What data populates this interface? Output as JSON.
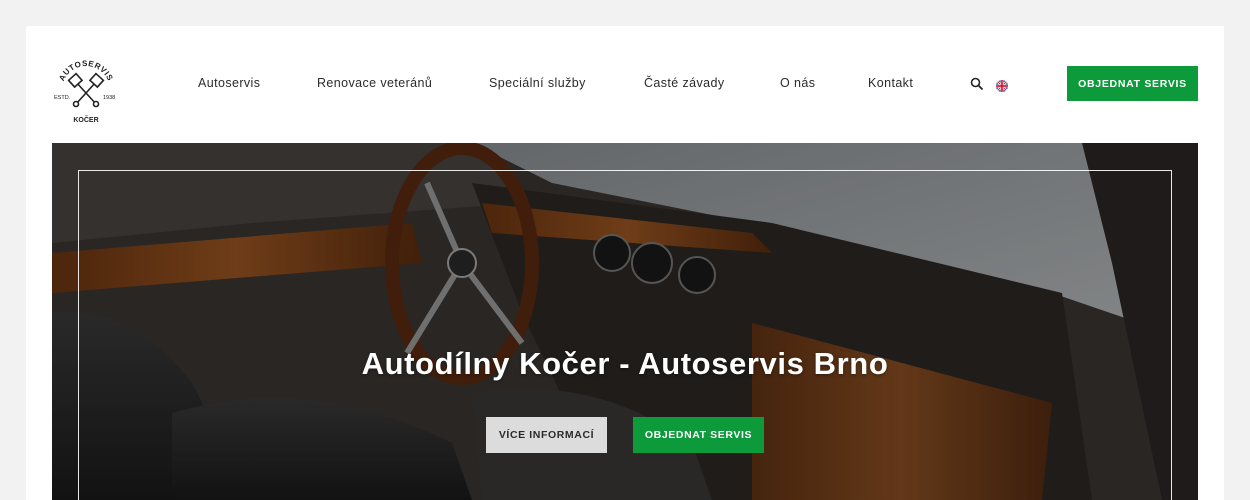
{
  "brand": {
    "logo_top": "AUTOSERVIS",
    "logo_left": "ESTD.",
    "logo_right": "1938",
    "logo_bottom": "KOČER"
  },
  "nav": {
    "items": [
      {
        "label": "Autoservis"
      },
      {
        "label": "Renovace veteránů"
      },
      {
        "label": "Speciální služby"
      },
      {
        "label": "Časté závady"
      },
      {
        "label": "O nás"
      },
      {
        "label": "Kontakt"
      }
    ],
    "search_icon": "search-icon",
    "language_icon": "uk-flag-icon",
    "cta_label": "OBJEDNAT SERVIS"
  },
  "hero": {
    "title": "Autodílny Kočer - Autoservis Brno",
    "primary_button": "VÍCE INFORMACÍ",
    "secondary_button": "OBJEDNAT SERVIS"
  },
  "colors": {
    "accent_green": "#0c9a3b",
    "light_button": "#dcdcdc",
    "page_background": "#f2f2f2"
  }
}
